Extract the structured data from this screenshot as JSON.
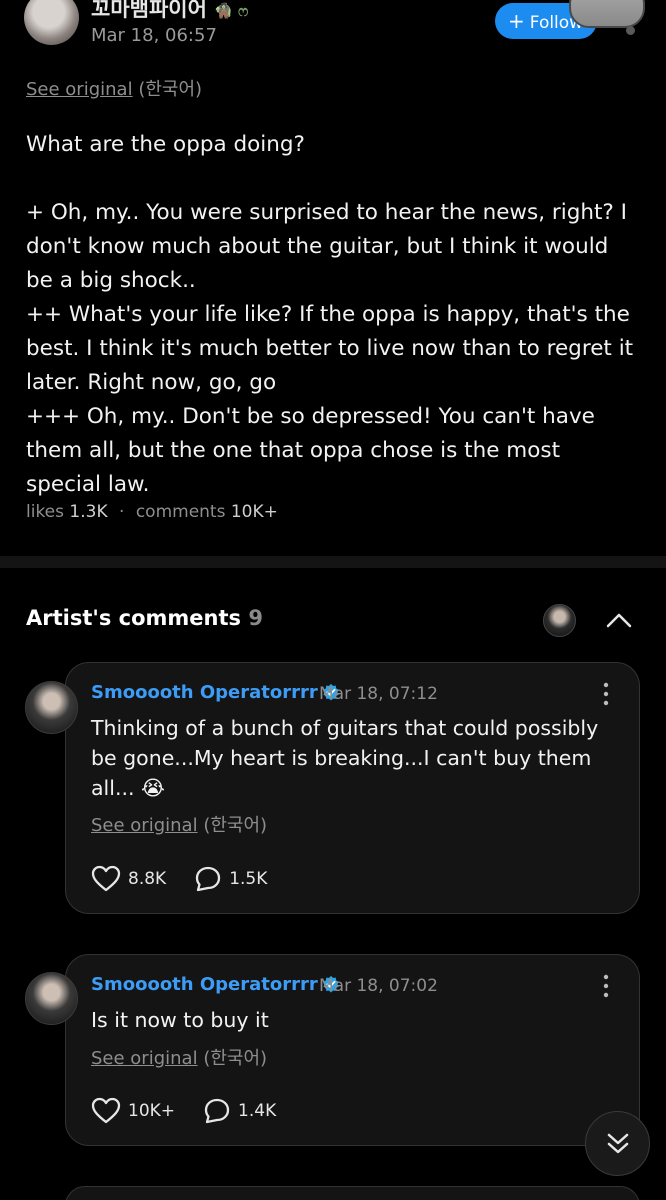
{
  "post": {
    "author": "꼬마뱀파이어",
    "author_badge": "🧌 ෆ",
    "time": "Mar 18, 06:57",
    "follow_label": "Follow",
    "see_original": "See original",
    "original_lang": "(한국어)",
    "body": [
      "What are the oppa doing?",
      "",
      "+ Oh, my.. You were surprised to hear the news, right? I don't know much about the guitar, but I think it would be a big shock..",
      "++ What's your life like? If the oppa is happy, that's the best. I think it's much better to live now than to regret it later. Right now, go, go",
      "+++ Oh, my.. Don't be so depressed! You can't have them all, but the one that oppa chose is the most special law."
    ],
    "likes_label": "likes",
    "likes": "1.3K",
    "separator": "·",
    "comments_label": "comments",
    "comments": "10K+"
  },
  "artist_comments": {
    "title": "Artist's comments",
    "count": "9",
    "items": [
      {
        "author": "Smooooth Operatorrrr",
        "time": "Mar 18, 07:12",
        "text": "Thinking of a bunch of guitars that could possibly be gone...My heart is breaking...I can't buy them all... 😭",
        "see_original": "See original",
        "original_lang": "(한국어)",
        "likes": "8.8K",
        "replies": "1.5K"
      },
      {
        "author": "Smooooth Operatorrrr",
        "time": "Mar 18, 07:02",
        "text": "Is it now to buy it",
        "see_original": "See original",
        "original_lang": "(한국어)",
        "likes": "10K+",
        "replies": "1.4K"
      }
    ]
  },
  "colors": {
    "background": "#000000",
    "accent_blue": "#1d8cf0",
    "author_blue": "#3d9cf5",
    "card_bg": "#141414",
    "muted_text": "#8e8e8e",
    "verified_badge": "#2aa5e9"
  },
  "icons": {
    "verified": "verified-check-icon",
    "more": "more-vertical-icon",
    "like": "heart-icon",
    "reply": "speech-bubble-icon",
    "collapse": "chevron-up-icon",
    "scroll": "double-chevron-down-icon"
  }
}
